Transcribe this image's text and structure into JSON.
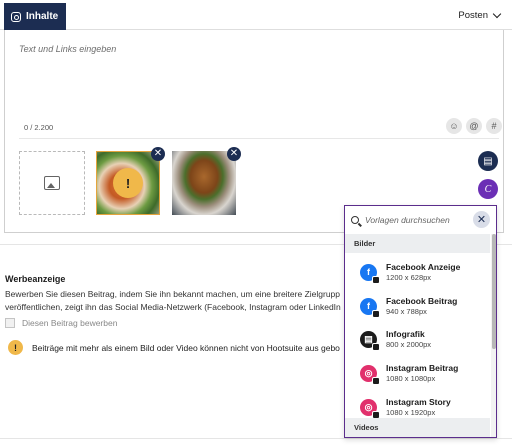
{
  "header": {
    "tab_label": "Inhalte",
    "post_menu_label": "Posten"
  },
  "editor": {
    "placeholder": "Text und Links eingeben",
    "char_counter": "0 / 2.200",
    "tools": {
      "emoji": "☺",
      "mention": "@",
      "hashtag": "#"
    }
  },
  "media": {
    "thumbnails": [
      {
        "warning": true
      },
      {
        "warning": false
      }
    ],
    "remove_glyph": "✕"
  },
  "ad": {
    "title": "Werbeanzeige",
    "description_lines": [
      "Bewerben Sie diesen Beitrag, indem Sie ihn bekannt machen, um eine breitere Zielgrupp",
      "veröffentlichen, zeigt ihn das Social Media-Netzwerk (Facebook, Instagram oder LinkedIn"
    ],
    "checkbox_label": "Diesen Beitrag bewerben",
    "info_message": "Beiträge mit mehr als einem Bild oder Video können nicht von Hootsuite aus gebo"
  },
  "templates": {
    "search_placeholder": "Vorlagen durchsuchen",
    "group_images": "Bilder",
    "group_videos": "Videos",
    "items": [
      {
        "name": "Facebook Anzeige",
        "size": "1200 x 628px",
        "icon": "facebook-icon",
        "color": "#1877f2"
      },
      {
        "name": "Facebook Beitrag",
        "size": "940 x 788px",
        "icon": "facebook-icon",
        "color": "#1877f2"
      },
      {
        "name": "Infografik",
        "size": "800 x 2000px",
        "icon": "infographic-icon",
        "color": "#1c1c1c"
      },
      {
        "name": "Instagram Beitrag",
        "size": "1080 x 1080px",
        "icon": "instagram-icon",
        "color": "#e1306c"
      },
      {
        "name": "Instagram Story",
        "size": "1080 x 1920px",
        "icon": "instagram-icon",
        "color": "#e1306c"
      }
    ]
  },
  "colors": {
    "brand_navy": "#1c2d52",
    "accent_purple": "#6b2fb5",
    "warning_yellow": "#f0b84a"
  }
}
